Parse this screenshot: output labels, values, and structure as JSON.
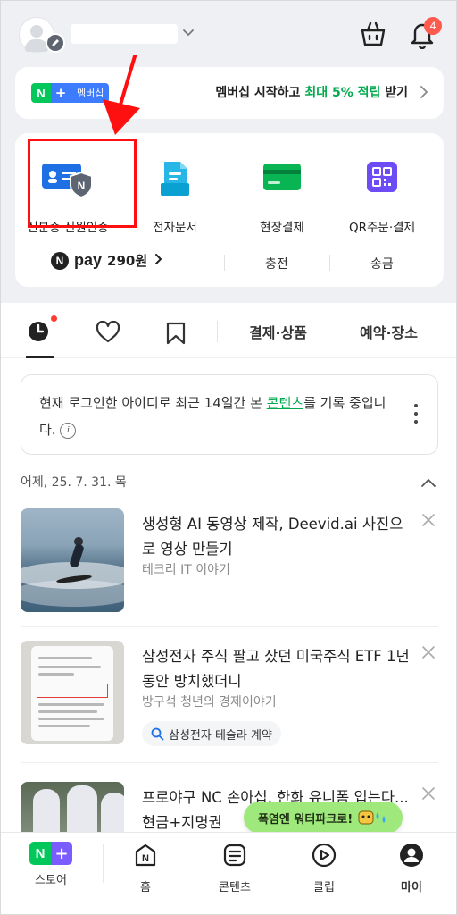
{
  "header": {
    "notification_count": "4"
  },
  "membership_banner": {
    "badge_n": "N",
    "badge_plus": "+",
    "badge_label": "멤버십",
    "text_prefix": "멤버십 시작하고 ",
    "text_highlight": "최대 5% 적립",
    "text_suffix": " 받기",
    "highlight_color": "#03a94e"
  },
  "quick_menu": {
    "items": [
      {
        "label": "신분증·신원인증",
        "icon": "id-card-shield-icon"
      },
      {
        "label": "전자문서",
        "icon": "document-icon"
      },
      {
        "label": "현장결제",
        "icon": "card-payment-icon"
      },
      {
        "label": "QR주문·결제",
        "icon": "qr-code-icon"
      }
    ],
    "pay": {
      "n": "N",
      "word": "pay",
      "amount": "290원",
      "charge": "충전",
      "send": "송금"
    }
  },
  "tabs": {
    "payment": "결제·상품",
    "reservation": "예약·장소"
  },
  "notice": {
    "text_before": "현재 로그인한 아이디로 최근 14일간 본 ",
    "link": "콘텐츠",
    "text_after": "를 기록 중입니다.",
    "info_glyph": "i"
  },
  "feed": {
    "date": "어제, 25. 7. 31. 목",
    "items": [
      {
        "title": "생성형 AI 동영상 제작, Deevid.ai 사진으로 영상 만들기",
        "source": "테크리 IT 이야기"
      },
      {
        "title": "삼성전자 주식 팔고 샀던 미국주식 ETF 1년 동안 방치했더니",
        "source": "방구석 청년의 경제이야기",
        "tag": "삼성전자 테슬라 계약"
      },
      {
        "title": "프로야구 NC 손아섭, 한화 유니폼 입는다...현금+지명권"
      }
    ]
  },
  "float_banner": {
    "label": "폭염엔 워터파크로!"
  },
  "bottom_nav": {
    "items": [
      {
        "label": "스토어"
      },
      {
        "label": "홈"
      },
      {
        "label": "콘텐츠"
      },
      {
        "label": "클립"
      },
      {
        "label": "마이"
      }
    ],
    "store_n": "N",
    "store_plus": "+",
    "home_n": "N"
  }
}
